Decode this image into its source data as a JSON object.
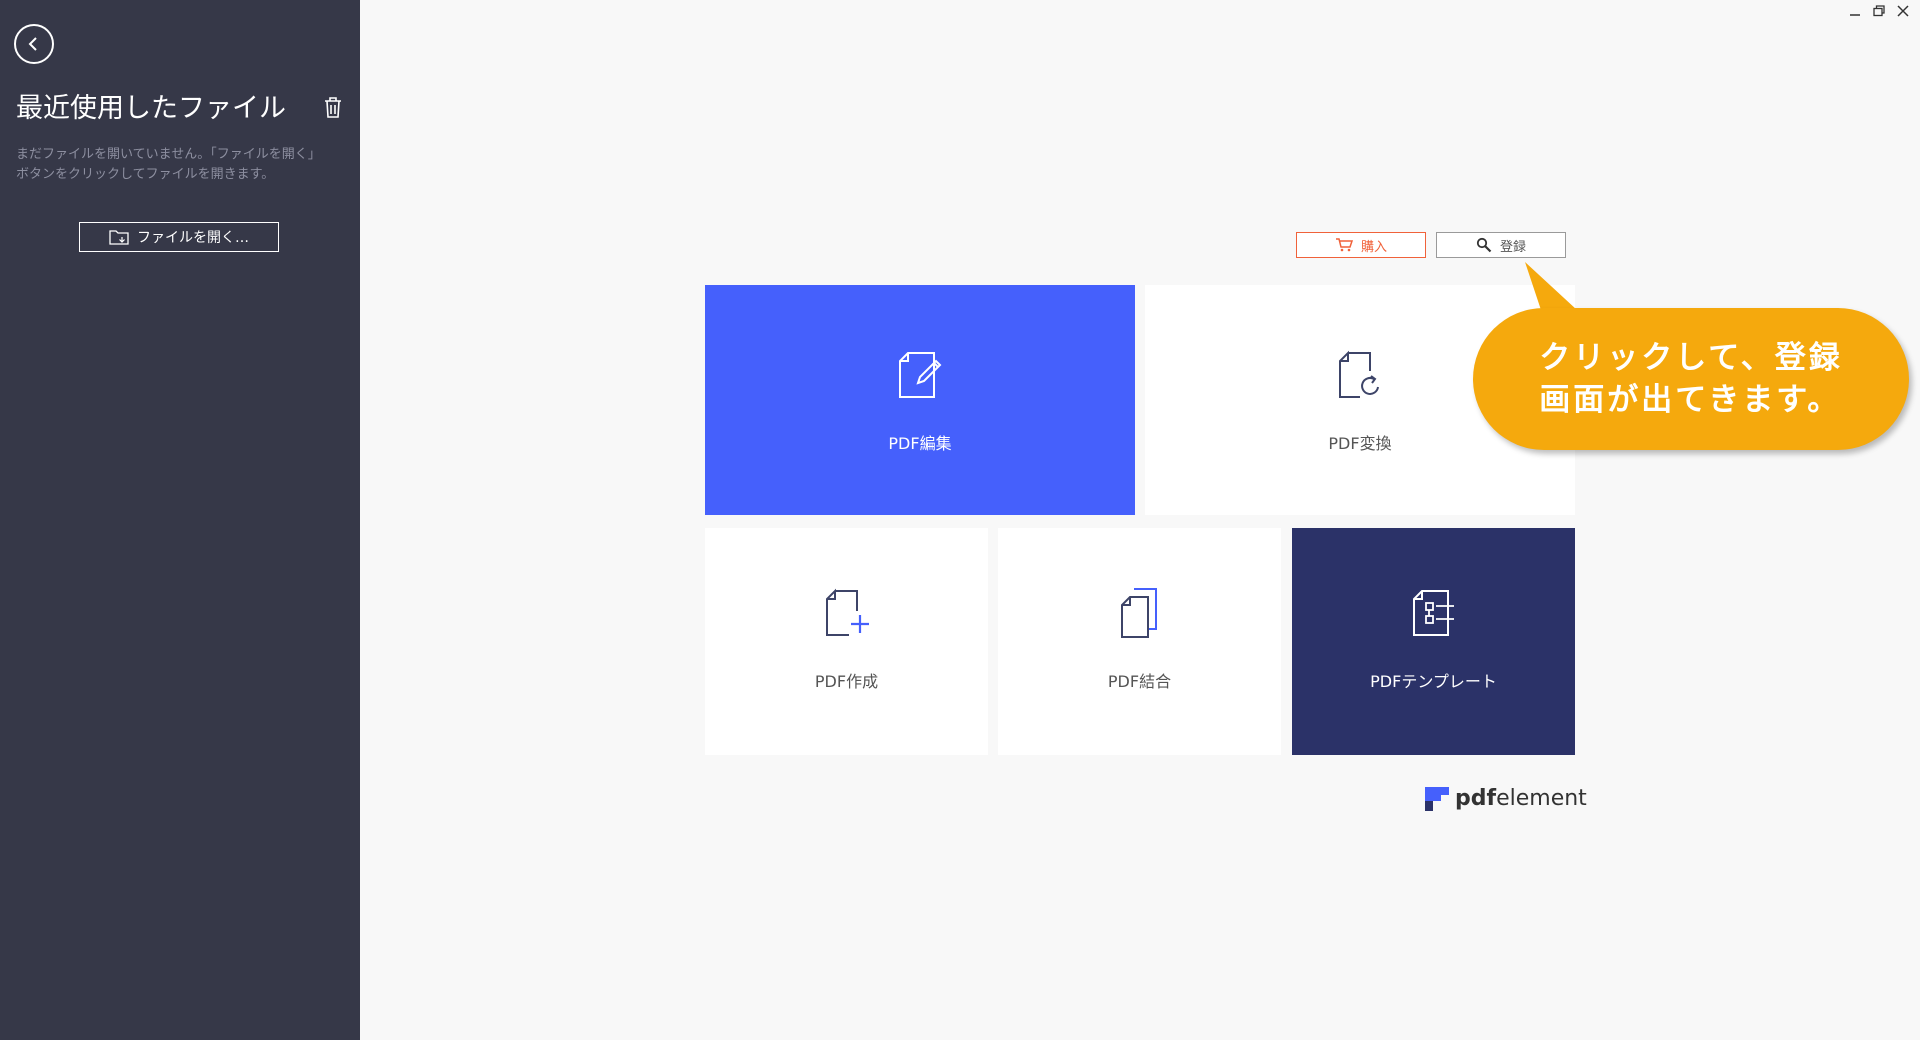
{
  "sidebar": {
    "title": "最近使用したファイル",
    "description": "まだファイルを開いていません。「ファイルを開く」ボタンをクリックしてファイルを開きます。",
    "open_file_label": "ファイルを開く…"
  },
  "header": {
    "buy_label": "購入",
    "register_label": "登録"
  },
  "tiles": [
    {
      "label": "PDF編集",
      "icon": "edit-document-icon"
    },
    {
      "label": "PDF変換",
      "icon": "convert-document-icon"
    },
    {
      "label": "PDF作成",
      "icon": "create-document-icon"
    },
    {
      "label": "PDF結合",
      "icon": "combine-documents-icon"
    },
    {
      "label": "PDFテンプレート",
      "icon": "template-icon"
    }
  ],
  "logo": {
    "strong": "pdf",
    "rest": "element"
  },
  "callout": {
    "text": "クリックして、登録\n画面が出てきます。"
  },
  "colors": {
    "sidebar_bg": "#363848",
    "accent_blue": "#4560fc",
    "template_navy": "#2b3268",
    "buy_orange": "#f0623a",
    "callout_orange": "#f5a90d"
  }
}
